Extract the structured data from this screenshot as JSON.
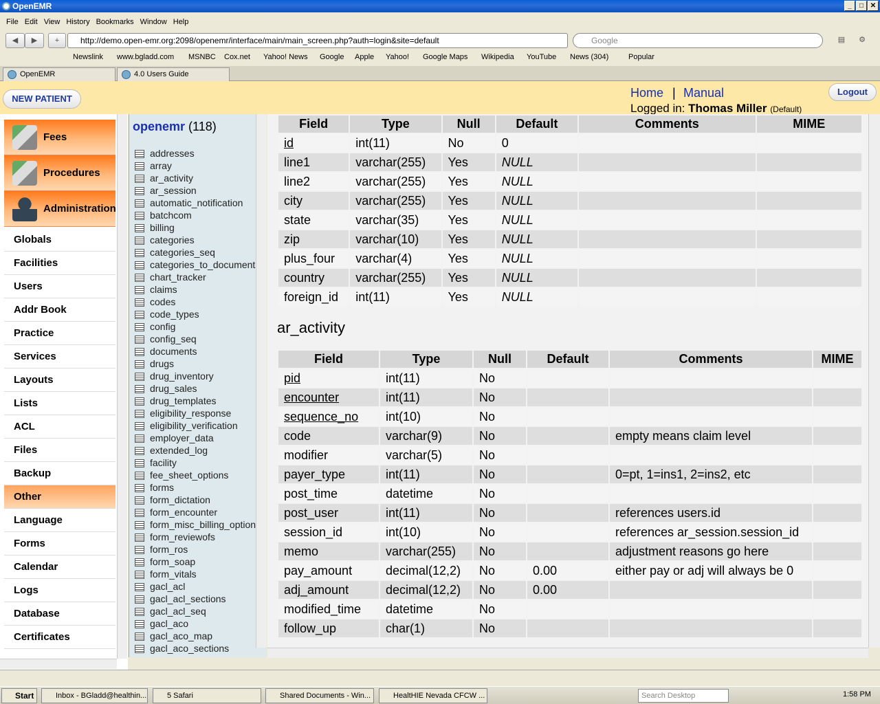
{
  "window": {
    "title": "OpenEMR"
  },
  "menubar": [
    "File",
    "Edit",
    "View",
    "History",
    "Bookmarks",
    "Window",
    "Help"
  ],
  "url": "http://demo.open-emr.org:2098/openemr/interface/main/main_screen.php?auth=login&site=default",
  "search_placeholder": "Google",
  "bookmarks": [
    "Newslink",
    "www.bgladd.com",
    "MSNBC",
    "Cox.net",
    "Yahoo! News",
    "Google",
    "Apple",
    "Yahoo!",
    "Google Maps",
    "Wikipedia",
    "YouTube",
    "News (304)",
    "Popular"
  ],
  "tabs": [
    "OpenEMR",
    "4.0 Users Guide"
  ],
  "header": {
    "new_patient": "NEW PATIENT",
    "home": "Home",
    "separator": "|",
    "manual": "Manual",
    "logged_in_label": "Logged in:",
    "user": "Thomas Miller",
    "user_suffix": "(Default)",
    "logout": "Logout"
  },
  "leftnav": {
    "orange": [
      "Fees",
      "Procedures",
      "Administration"
    ],
    "items": [
      "Globals",
      "Facilities",
      "Users",
      "Addr Book",
      "Practice",
      "Services",
      "Layouts",
      "Lists",
      "ACL",
      "Files",
      "Backup",
      "Other",
      "Language",
      "Forms",
      "Calendar",
      "Logs",
      "Database",
      "Certificates"
    ]
  },
  "db": {
    "name": "openemr",
    "count": "(118)",
    "tables": [
      "addresses",
      "array",
      "ar_activity",
      "ar_session",
      "automatic_notification",
      "batchcom",
      "billing",
      "categories",
      "categories_seq",
      "categories_to_documents",
      "chart_tracker",
      "claims",
      "codes",
      "code_types",
      "config",
      "config_seq",
      "documents",
      "drugs",
      "drug_inventory",
      "drug_sales",
      "drug_templates",
      "eligibility_response",
      "eligibility_verification",
      "employer_data",
      "extended_log",
      "facility",
      "fee_sheet_options",
      "forms",
      "form_dictation",
      "form_encounter",
      "form_misc_billing_options",
      "form_reviewofs",
      "form_ros",
      "form_soap",
      "form_vitals",
      "gacl_acl",
      "gacl_acl_sections",
      "gacl_acl_seq",
      "gacl_aco",
      "gacl_aco_map",
      "gacl_aco_sections"
    ]
  },
  "table1": {
    "headers": [
      "Field",
      "Type",
      "Null",
      "Default",
      "Comments",
      "MIME"
    ],
    "rows": [
      [
        "id",
        "int(11)",
        "No",
        "0",
        "",
        ""
      ],
      [
        "line1",
        "varchar(255)",
        "Yes",
        "NULL",
        "",
        ""
      ],
      [
        "line2",
        "varchar(255)",
        "Yes",
        "NULL",
        "",
        ""
      ],
      [
        "city",
        "varchar(255)",
        "Yes",
        "NULL",
        "",
        ""
      ],
      [
        "state",
        "varchar(35)",
        "Yes",
        "NULL",
        "",
        ""
      ],
      [
        "zip",
        "varchar(10)",
        "Yes",
        "NULL",
        "",
        ""
      ],
      [
        "plus_four",
        "varchar(4)",
        "Yes",
        "NULL",
        "",
        ""
      ],
      [
        "country",
        "varchar(255)",
        "Yes",
        "NULL",
        "",
        ""
      ],
      [
        "foreign_id",
        "int(11)",
        "Yes",
        "NULL",
        "",
        ""
      ]
    ]
  },
  "section2_title": "ar_activity",
  "table2": {
    "headers": [
      "Field",
      "Type",
      "Null",
      "Default",
      "Comments",
      "MIME"
    ],
    "rows": [
      [
        "pid",
        "int(11)",
        "No",
        "",
        "",
        ""
      ],
      [
        "encounter",
        "int(11)",
        "No",
        "",
        "",
        ""
      ],
      [
        "sequence_no",
        "int(10)",
        "No",
        "",
        "",
        ""
      ],
      [
        "code",
        "varchar(9)",
        "No",
        "",
        "empty means claim level",
        ""
      ],
      [
        "modifier",
        "varchar(5)",
        "No",
        "",
        "",
        ""
      ],
      [
        "payer_type",
        "int(11)",
        "No",
        "",
        "0=pt, 1=ins1, 2=ins2, etc",
        ""
      ],
      [
        "post_time",
        "datetime",
        "No",
        "",
        "",
        ""
      ],
      [
        "post_user",
        "int(11)",
        "No",
        "",
        "references users.id",
        ""
      ],
      [
        "session_id",
        "int(10)",
        "No",
        "",
        "references ar_session.session_id",
        ""
      ],
      [
        "memo",
        "varchar(255)",
        "No",
        "",
        "adjustment reasons go here",
        ""
      ],
      [
        "pay_amount",
        "decimal(12,2)",
        "No",
        "0.00",
        "either pay or adj will always be 0",
        ""
      ],
      [
        "adj_amount",
        "decimal(12,2)",
        "No",
        "0.00",
        "",
        ""
      ],
      [
        "modified_time",
        "datetime",
        "No",
        "",
        "",
        ""
      ],
      [
        "follow_up",
        "char(1)",
        "No",
        "",
        "",
        ""
      ]
    ]
  },
  "taskbar": {
    "start": "Start",
    "tasks": [
      "Inbox - BGladd@healthin...",
      "5 Safari",
      "Shared Documents - Win...",
      "HealtHIE Nevada CFCW ..."
    ],
    "search": "Search Desktop",
    "clock": "1:58 PM"
  }
}
